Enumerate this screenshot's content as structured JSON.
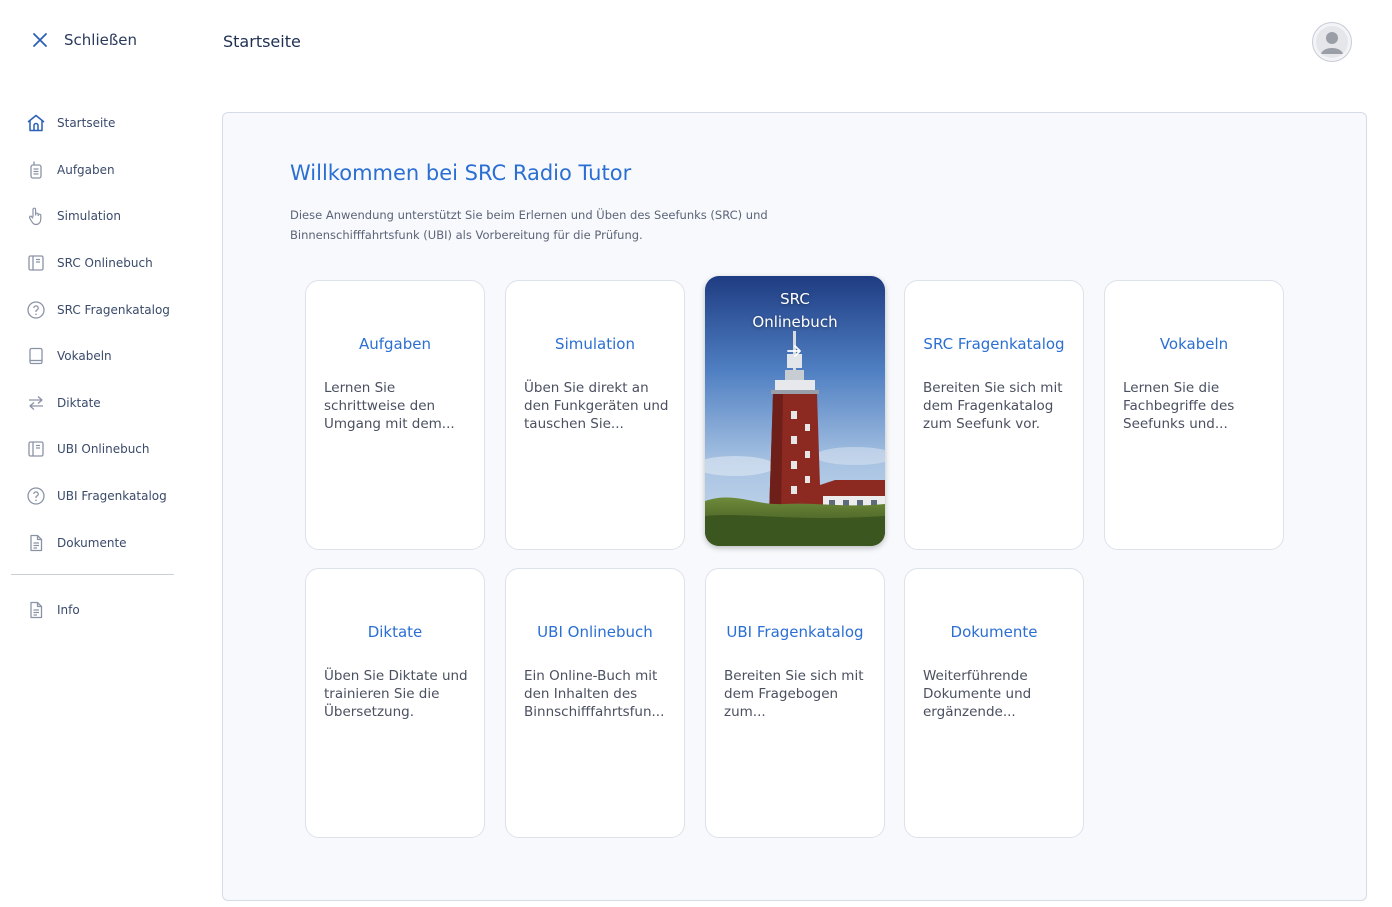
{
  "sidebar": {
    "close_label": "Schließen",
    "items": [
      {
        "label": "Startseite",
        "icon": "home-icon"
      },
      {
        "label": "Aufgaben",
        "icon": "radio-icon"
      },
      {
        "label": "Simulation",
        "icon": "hand-pointer-icon"
      },
      {
        "label": "SRC Onlinebuch",
        "icon": "book-open-icon"
      },
      {
        "label": "SRC Fragenkatalog",
        "icon": "question-circle-icon"
      },
      {
        "label": "Vokabeln",
        "icon": "notebook-icon"
      },
      {
        "label": "Diktate",
        "icon": "swap-arrows-icon"
      },
      {
        "label": "UBI Onlinebuch",
        "icon": "book-open-icon"
      },
      {
        "label": "UBI Fragenkatalog",
        "icon": "question-circle-icon"
      },
      {
        "label": "Dokumente",
        "icon": "document-icon"
      }
    ],
    "info_label": "Info"
  },
  "header": {
    "title": "Startseite"
  },
  "main": {
    "welcome_title": "Willkommen bei SRC Radio Tutor",
    "intro_text": "Diese Anwendung unterstützt Sie beim Erlernen und Üben des Seefunks (SRC) und Binnenschifffahrtsfunk (UBI) als Vorbereitung für die Prüfung.",
    "cards": [
      {
        "title": "Aufgaben",
        "description": "Lernen Sie schrittweise den Umgang mit dem..."
      },
      {
        "title": "Simulation",
        "description": "Üben Sie direkt an den Funkgeräten und tauschen Sie..."
      },
      {
        "title": "SRC Onlinebuch",
        "title_line1": "SRC",
        "title_line2": "Onlinebuch",
        "image": "lighthouse-photo"
      },
      {
        "title": "SRC Fragenkatalog",
        "description": "Bereiten Sie sich mit dem Fragenkatalog zum Seefunk vor."
      },
      {
        "title": "Vokabeln",
        "description": "Lernen Sie die Fachbegriffe des Seefunks und..."
      },
      {
        "title": "Diktate",
        "description": "Üben Sie Diktate und trainieren Sie die Übersetzung."
      },
      {
        "title": "UBI Onlinebuch",
        "description": "Ein Online-Buch mit den Inhalten des Binnschifffahrtsfun..."
      },
      {
        "title": "UBI Fragenkatalog",
        "description": "Bereiten Sie sich mit dem Fragebogen zum..."
      },
      {
        "title": "Dokumente",
        "description": "Weiterführende Dokumente und ergänzende..."
      }
    ]
  },
  "colors": {
    "accent": "#2b6fd3",
    "panel_bg": "#f7f9fc",
    "text_dark": "#2a3a5c"
  }
}
